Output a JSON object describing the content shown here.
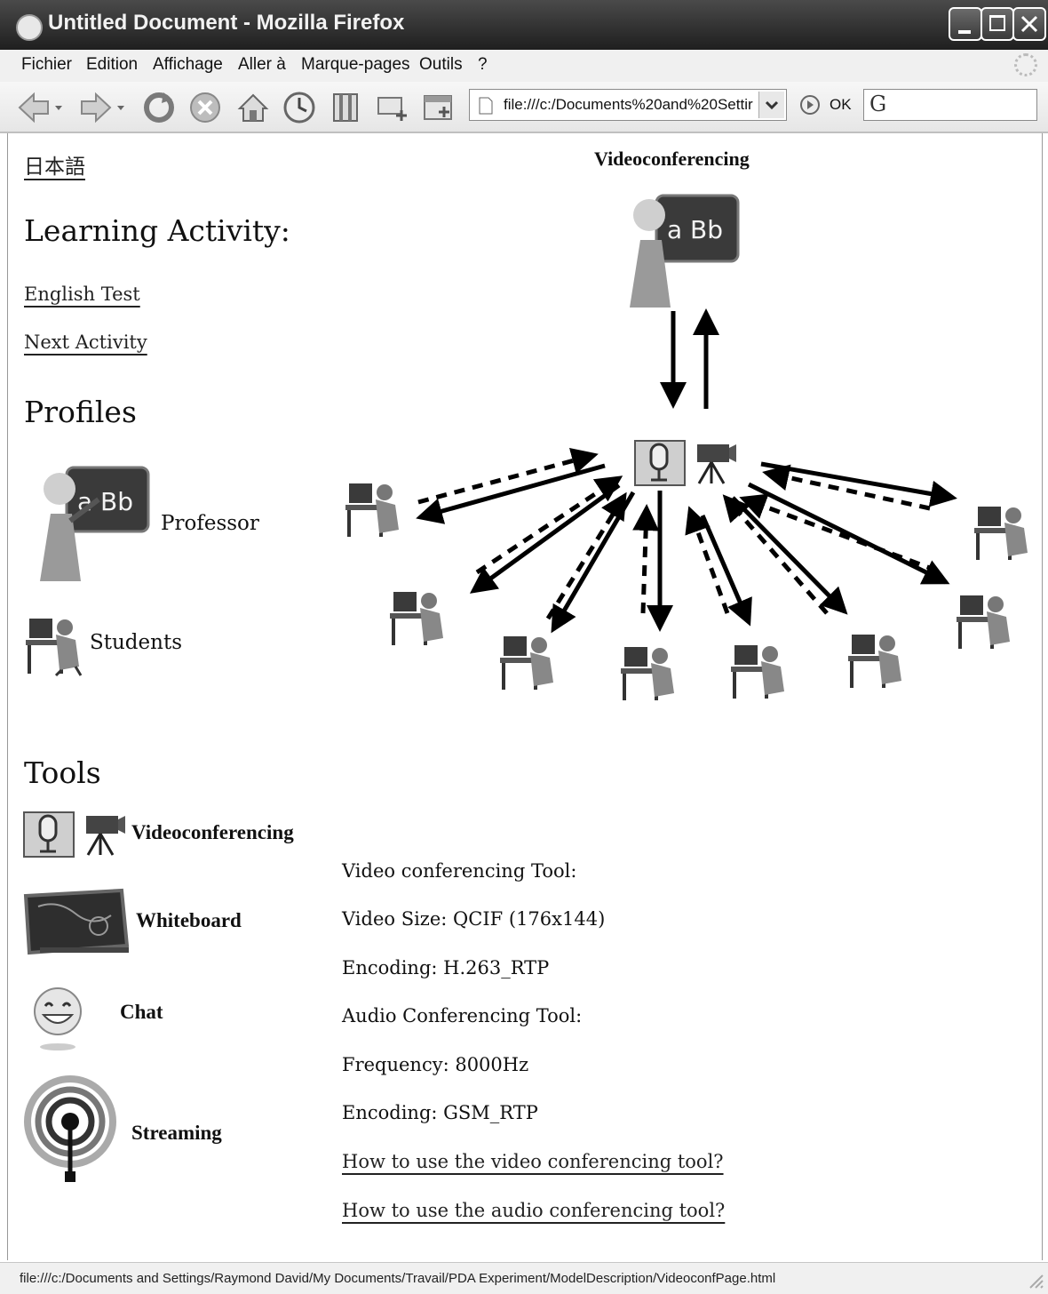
{
  "window": {
    "title": "Untitled Document - Mozilla Firefox"
  },
  "menu": [
    "Fichier",
    "Edition",
    "Affichage",
    "Aller à",
    "Marque-pages",
    "Outils",
    "?"
  ],
  "toolbar": {
    "url": "file:///c:/Documents%20and%20Settir",
    "go_label": "OK",
    "search_value": ""
  },
  "page": {
    "lang_link": "日本語",
    "learning_heading": "Learning Activity:",
    "activity_links": [
      "English Test",
      "Next Activity"
    ],
    "profiles_heading": "Profiles",
    "profiles": [
      "Professor",
      "Students"
    ],
    "diagram_title": "Videoconferencing",
    "tools_heading": "Tools",
    "tools": [
      "Videoconferencing",
      "Whiteboard",
      "Chat",
      "Streaming"
    ],
    "info_lines": [
      "Video conferencing Tool:",
      "Video Size: QCIF (176x144)",
      "Encoding: H.263_RTP",
      "Audio Conferencing Tool:",
      "Frequency: 8000Hz",
      "Encoding: GSM_RTP"
    ],
    "help_links": [
      "How to use the video conferencing tool?",
      "How to use the audio conferencing tool?"
    ]
  },
  "status": "file:///c:/Documents and Settings/Raymond David/My Documents/Travail/PDA Experiment/ModelDescription/VideoconfPage.html"
}
